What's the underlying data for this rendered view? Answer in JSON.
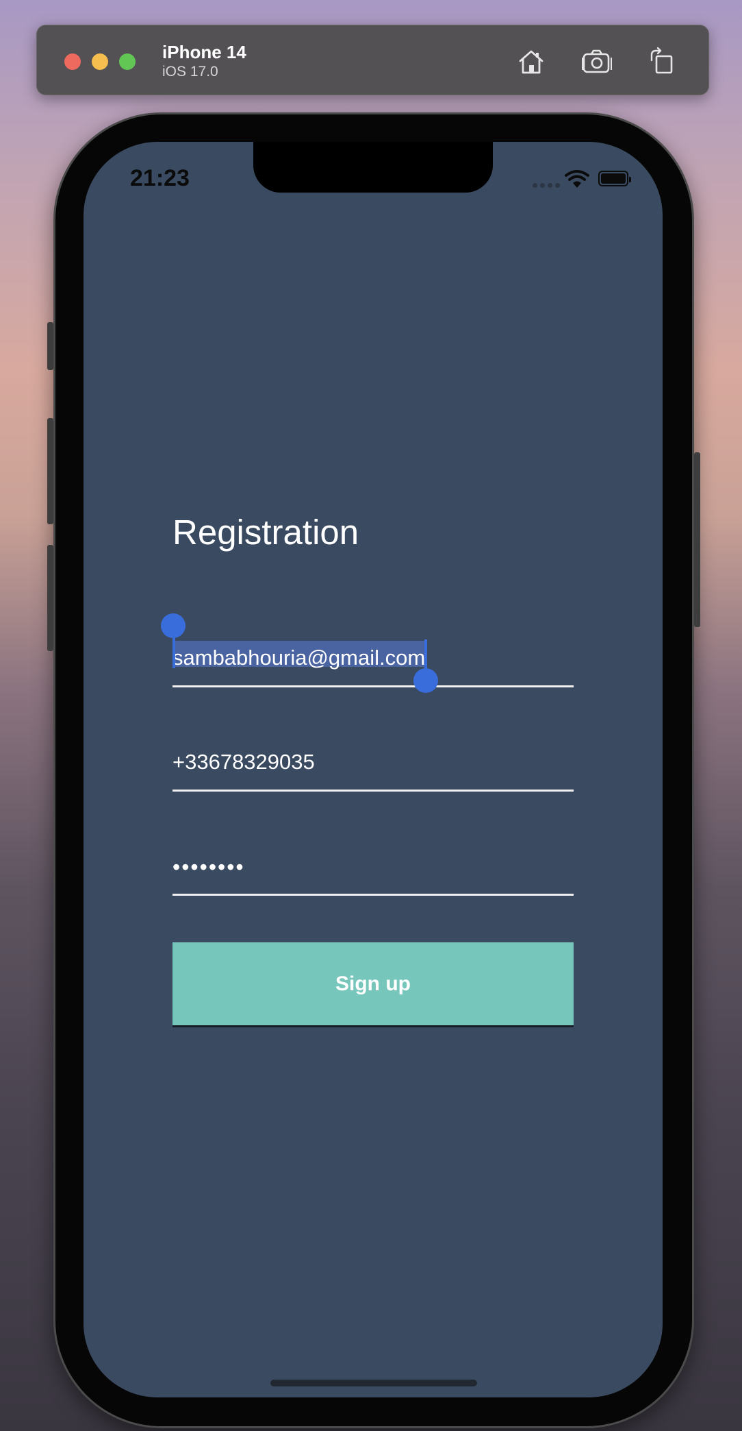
{
  "simulator": {
    "device_name": "iPhone 14",
    "os_version": "iOS 17.0",
    "icons": [
      "home-icon",
      "screenshot-icon",
      "rotate-icon"
    ]
  },
  "status_bar": {
    "time": "21:23",
    "icons": [
      "wifi-icon",
      "battery-icon"
    ]
  },
  "app": {
    "title": "Registration",
    "email_value": "sambabhouria@gmail.com",
    "phone_value": "+33678329035",
    "password_value": "••••••••",
    "signup_label": "Sign up"
  },
  "colors": {
    "screen_background": "#3a4a60",
    "button_background": "#77c6bb",
    "selection_handle": "#3a6ddc"
  }
}
